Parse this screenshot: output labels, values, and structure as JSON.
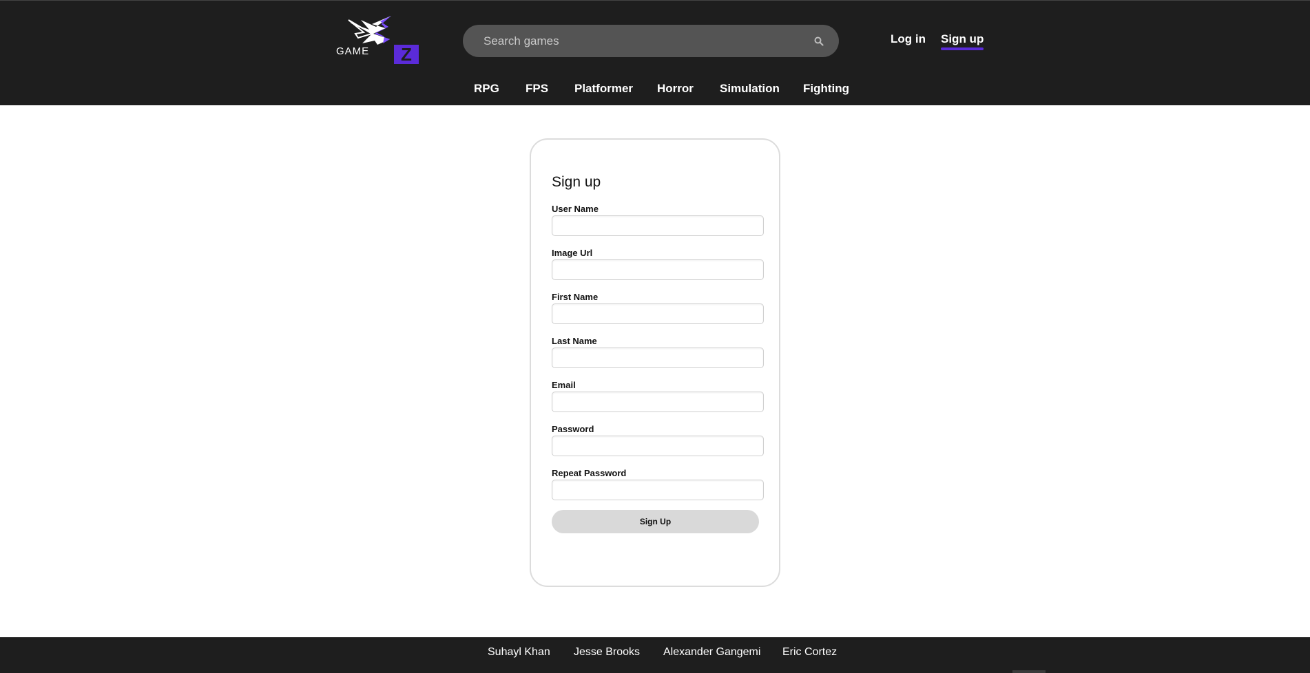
{
  "brand": {
    "logo_text": "GAME",
    "logo_letter": "Z",
    "accent_color": "#5b2bd9"
  },
  "header": {
    "search": {
      "placeholder": "Search games",
      "value": ""
    },
    "auth": {
      "login_label": "Log in",
      "signup_label": "Sign up"
    },
    "nav": {
      "items": [
        "RPG",
        "FPS",
        "Platformer",
        "Horror",
        "Simulation",
        "Fighting"
      ]
    }
  },
  "form": {
    "title": "Sign up",
    "fields": [
      {
        "label": "User Name",
        "value": ""
      },
      {
        "label": "Image Url",
        "value": ""
      },
      {
        "label": "First Name",
        "value": ""
      },
      {
        "label": "Last Name",
        "value": ""
      },
      {
        "label": "Email",
        "value": ""
      },
      {
        "label": "Password",
        "value": ""
      },
      {
        "label": "Repeat Password",
        "value": ""
      }
    ],
    "submit_label": "Sign Up"
  },
  "footer": {
    "names": [
      "Suhayl Khan",
      "Jesse Brooks",
      "Alexander Gangemi",
      "Eric Cortez"
    ]
  }
}
